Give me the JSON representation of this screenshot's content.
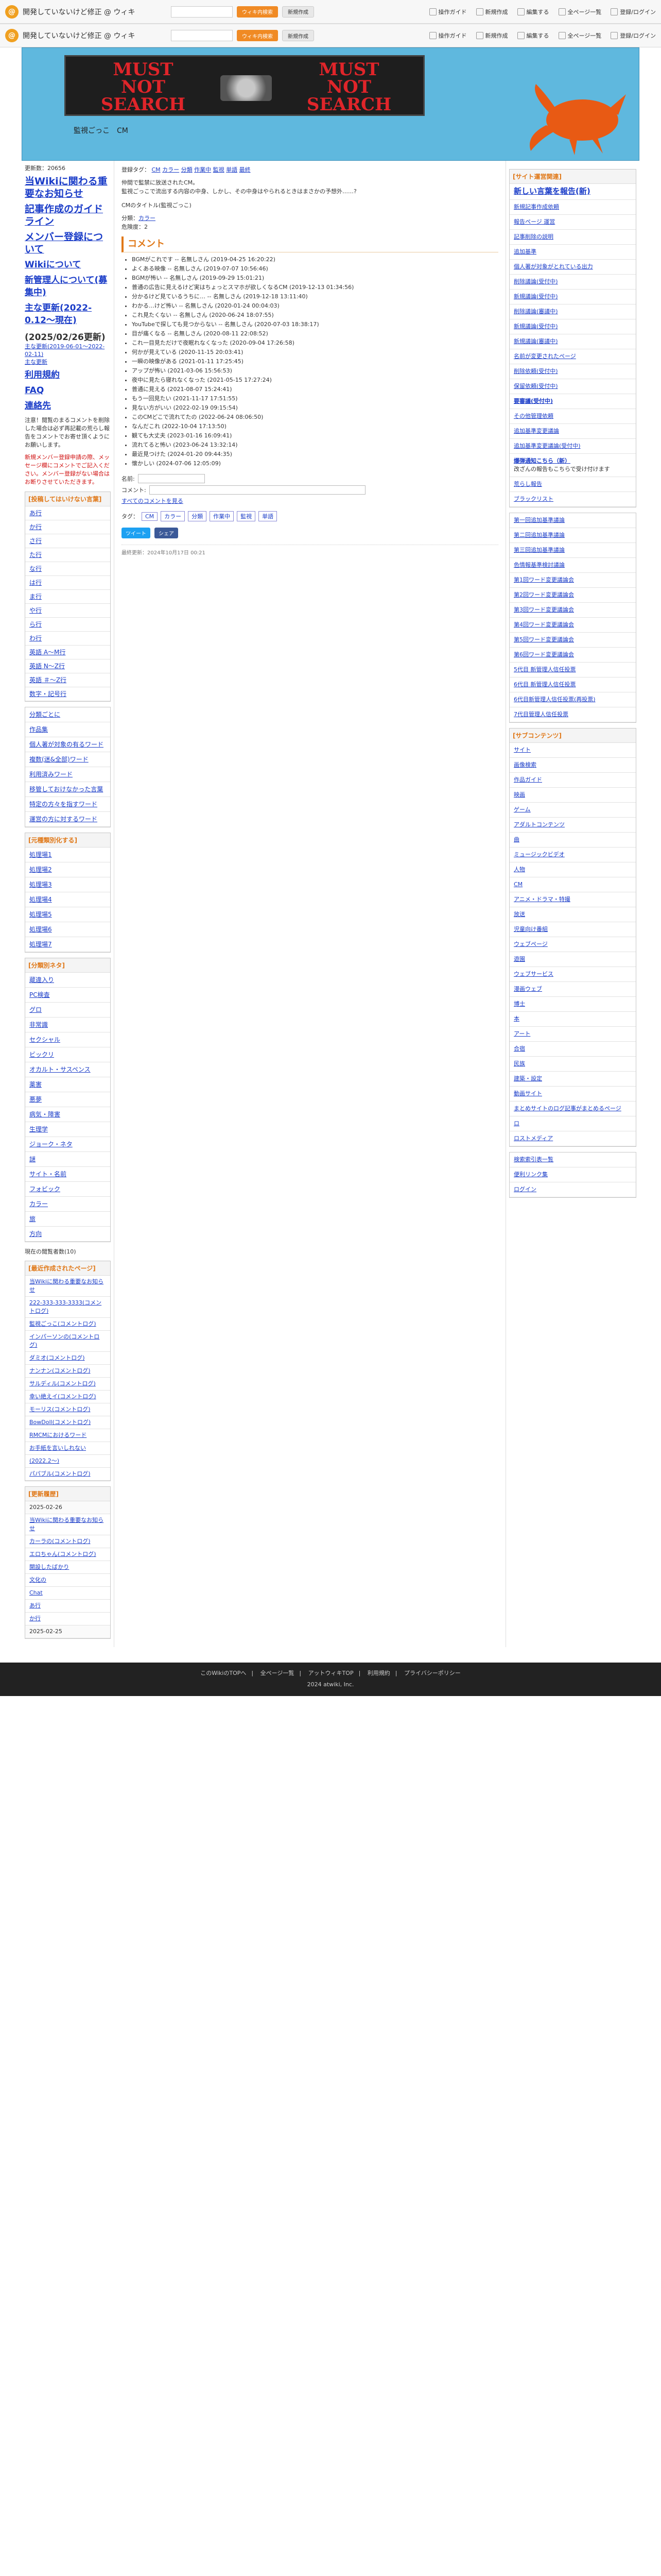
{
  "topbar": {
    "title": "開発していないけど修正 @ ウィキ",
    "search_btn": "ウィキ内検索",
    "new_btn": "新規作成",
    "links": [
      "操作ガイド",
      "新規作成",
      "編集する",
      "全ページ一覧",
      "登録/ログイン"
    ]
  },
  "header": {
    "logo_text": [
      "MUST",
      "NOT",
      "SEARCH",
      "MUST",
      "NOT",
      "SEARCH"
    ],
    "site_title": "監視ごっこ　CM"
  },
  "left": {
    "update": "更新数：20656",
    "nav": [
      {
        "label": "当Wikiに関わる重要なお知らせ"
      },
      {
        "label": "記事作成のガイドライン"
      },
      {
        "label": "メンバー登録について"
      },
      {
        "label": "Wikiについて"
      },
      {
        "label": "新管理人について(募集中)"
      },
      {
        "label": "主な更新(2022-0.12～現在)"
      },
      {
        "label": "(2025/02/26更新)"
      }
    ],
    "small_links": [
      "主な更新(2019-06-01〜2022-02-11)",
      "主な更新",
      "利用規約",
      "FAQ",
      "連絡先"
    ],
    "notice": "注意！閲覧のまるコメントを削除した場合は必ず再記載の荒らし報告をコメントでお寄せ頂くようにお願いします。",
    "notice_red": "新規メンバー登録申請の際、メッセージ欄にコメントでご記入ください。メンバー登録がない場合はお断りさせていただきます。",
    "kana_title": "[投稿してはいけない言葉]",
    "kana": [
      "あ行",
      "か行",
      "さ行",
      "た行",
      "な行",
      "は行",
      "ま行",
      "や行",
      "ら行",
      "わ行",
      "英語 A〜M行",
      "英語 N〜Z行",
      "英語 ＃〜Z行",
      "数字・記号行"
    ],
    "misc": [
      "分類ごとに",
      "作品集",
      "個人著が対象の有るワード",
      "複数(迷&全部)ワード",
      "利用済みワード",
      "移管しておけなかった言葉",
      "特定の方々を指すワード",
      "運営の方に対するワード"
    ],
    "ceremony_title": "[元種類別化する]",
    "ceremony": [
      "処理場1",
      "処理場2",
      "処理場3",
      "処理場4",
      "処理場5",
      "処理場6",
      "処理場7"
    ],
    "genre_title": "[分類別ネタ]",
    "genre": [
      "蔵違入り",
      "PC検査",
      "グロ",
      "非常識",
      "セクシャル",
      "ビックリ",
      "オカルト・サスペンス",
      "薬害",
      "悪夢",
      "病気・障害",
      "生理学",
      "ジョーク・ネタ",
      "謎",
      "サイト・名前",
      "フォビック",
      "カラー",
      "旅",
      "方向"
    ],
    "history_title": "現在の閲覧者数(10)",
    "recent_title": "[最近作成されたページ]",
    "recent": [
      "当Wikiに関わる重要なお知らせ",
      "222-333-333-3333(コメントログ)",
      "監視ごっこ(コメントログ)",
      "インパーソンの(コメントログ)",
      "ダミオ(コメントログ)",
      "ナンナン(コメントログ)",
      "サルディル(コメントログ)",
      "幸い絶えイ(コメントログ)",
      "モーリス(コメントログ)",
      "BowDoll(コメントログ)",
      "RMCMにおけるワード",
      "お手紙を言いしれない",
      "(2022.2～)",
      "パパブル(コメントログ)"
    ],
    "update_title": "[更新履歴]",
    "updates": [
      "2025-02-26",
      "当Wikiに関わる重要なお知らせ",
      "カーラの(コメントログ)",
      "エロちゃん(コメントログ)",
      "開設したばかり",
      "文化の",
      "Chat",
      "あ行",
      "か行",
      "2025-02-25"
    ]
  },
  "main": {
    "meta_a": "登録タグ：",
    "meta_tags": [
      "CM",
      "カラー",
      "分類",
      "作業中",
      "監視",
      "単語",
      "最終"
    ],
    "meta_desc": "お知らせ",
    "desc_1": "仲間で監禁に放送されたCM。",
    "desc_2": "監視ごっこで流出する内容の中身、しかし、その中身はやられるときはまさかの予想外……?",
    "desc_3": "CMのタイトル(監視ごっこ)",
    "cat_label": "分類：",
    "cat_value": "カラー",
    "danger": "危険度：2",
    "comments_title": "コメント",
    "comments": [
      "BGMがこれです -- 名無しさん (2019-04-25 16:20:22)",
      "よくある映像 -- 名無しさん (2019-07-07 10:56:46)",
      "BGMが怖い -- 名無しさん (2019-09-29 15:01:21)",
      "普通の広告に見えるけど実はちょっとスマホが欲しくなるCM (2019-12-13 01:34:56)",
      "分かるけど見ているうちに… -- 名無しさん (2019-12-18 13:11:40)",
      "わかる…けど怖い -- 名無しさん (2020-01-24 00:04:03)",
      "これ見たくない -- 名無しさん (2020-06-24 18:07:55)",
      "YouTubeで探しても見つからない -- 名無しさん (2020-07-03 18:38:17)",
      "目が痛くなる -- 名無しさん (2020-08-11 22:08:52)",
      "これ一目見ただけで夜眠れなくなった (2020-09-04 17:26:58)",
      "何かが見えている (2020-11-15 20:03:41)",
      "一瞬の映像がある (2021-01-11 17:25:45)",
      "アップが怖い (2021-03-06 15:56:53)",
      "夜中に見たら寝れなくなった (2021-05-15 17:27:24)",
      "普通に見える (2021-08-07 15:24:41)",
      "もう一回見たい (2021-11-17 17:51:55)",
      "見ない方がいい (2022-02-19 09:15:54)",
      "このCMどこで流れてたの (2022-06-24 08:06:50)",
      "なんだこれ (2022-10-04 17:13:50)",
      "観ても大丈夫 (2023-01-16 16:09:41)",
      "流れてると怖い (2023-06-24 13:32:14)",
      "最近見つけた (2024-01-20 09:44:35)",
      "懐かしい (2024-07-06 12:05:09)"
    ],
    "form_name": "名前:",
    "form_comment": "コメント:",
    "form_submit": "すべてのコメントを見る",
    "tags_label": "タグ：",
    "tags": [
      "CM",
      "カラー",
      "分類",
      "作業中",
      "監視",
      "単語"
    ],
    "share_tweet": "ツイート",
    "share_fb": "シェア",
    "lastmod": "最終更新：2024年10月17日 00:21"
  },
  "right": {
    "title1": "[サイト運営関連]",
    "r1": [
      "新しい言葉を報告(新)",
      "新規記事作成依頼",
      "報告ページ 運営",
      "記事削除の説明",
      "追加基準",
      "個人著が対象がとれている出力",
      "削除議論(受付中)",
      "新規議論(受付中)",
      "削除議論(審議中)",
      "新規議論(受付中)",
      "新規議論(審議中)",
      "名前が変更されたページ",
      "削除依頼(受付中)",
      "保留依頼(受付中)",
      "要審議(受付中)",
      "その他管理依頼",
      "追加基準変更議論",
      "追加基準変更議論(受付中)"
    ],
    "notice": "爆弾通知こちら（新）",
    "notice_desc": "改ざんの報告もこちらで受け付けます",
    "r2": [
      "荒らし報告",
      "ブラックリスト"
    ],
    "r3": [
      "第一回追加基準議論",
      "第二回追加基準議論",
      "第三回追加基準議論",
      "色情報基準検討議論",
      "第1回ワード変更議論会",
      "第2回ワード変更議論会",
      "第3回ワード変更議論会",
      "第4回ワード変更議論会",
      "第5回ワード変更議論会",
      "第6回ワード変更議論会",
      "5代目 新管理人信任投票",
      "6代目 新管理人信任投票",
      "6代目新管理人信任投票(再投票)",
      "7代目管理人信任投票"
    ],
    "title2": "[サブコンテンツ]",
    "r4": [
      "サイト",
      "画像検索",
      "作品ガイド",
      "映画",
      "ゲーム",
      "アダルトコンテンツ",
      "曲",
      "ミュージックビデオ",
      "人物",
      "CM",
      "アニメ・ドラマ・特撮",
      "放送",
      "児童向け番組",
      "ウェブページ",
      "遊園",
      "ウェブサービス",
      "漫画ウェブ",
      "博士",
      "本",
      "アート",
      "合宿",
      "民族",
      "建築・設定",
      "動画サイト",
      "まとめサイトのログ記事がまとめるページ",
      "ロ",
      "ロストメディア"
    ],
    "search_title": "検索索引表一覧",
    "r5": [
      "便利リンク集",
      "ログイン"
    ]
  },
  "footer": {
    "links": [
      "このWikiのTOPへ",
      "全ページ一覧",
      "アットウィキTOP",
      "利用規約",
      "プライバシーポリシー"
    ],
    "copyright": "2024 atwiki, Inc."
  }
}
